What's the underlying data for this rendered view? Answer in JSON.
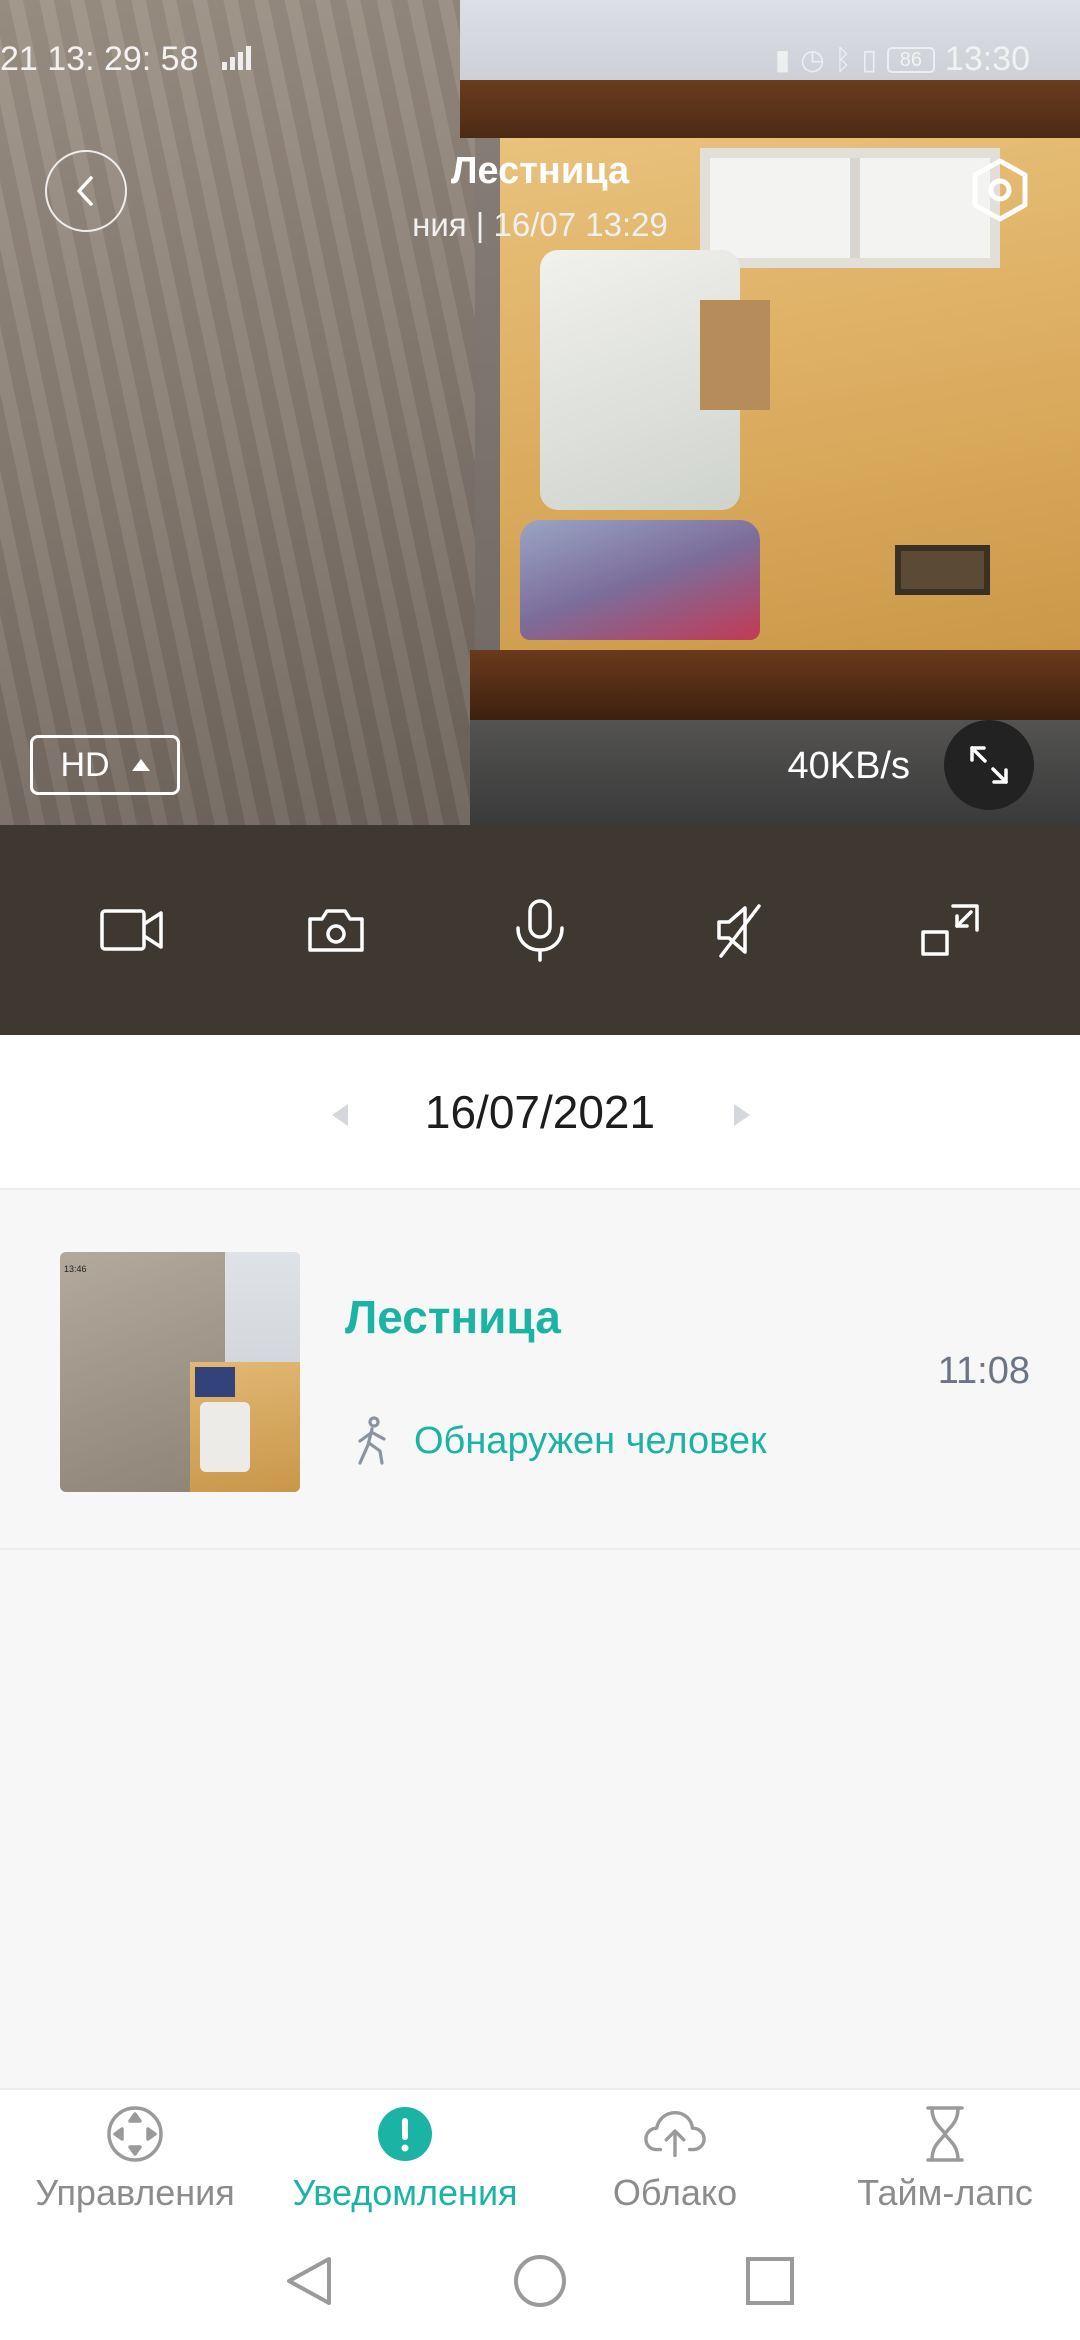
{
  "status_bar": {
    "left_time": "21  13: 29: 58",
    "battery": "86",
    "right_time": "13:30"
  },
  "header": {
    "title": "Лестница",
    "subtitle": "ния | 16/07 13:29"
  },
  "video": {
    "quality_label": "HD",
    "speed": "40KB/s"
  },
  "controls": {
    "items": [
      {
        "name": "record-video-icon"
      },
      {
        "name": "snapshot-camera-icon"
      },
      {
        "name": "microphone-icon"
      },
      {
        "name": "speaker-muted-icon"
      },
      {
        "name": "picture-in-picture-icon"
      }
    ]
  },
  "date_bar": {
    "date": "16/07/2021"
  },
  "event": {
    "title": "Лестница",
    "type": "Обнаружен человек",
    "time": "11:08",
    "thumb_timestamp": "13:46"
  },
  "bottom_nav": {
    "items": [
      {
        "label": "Управления",
        "icon": "control-icon",
        "active": false
      },
      {
        "label": "Уведомления",
        "icon": "alert-icon",
        "active": true
      },
      {
        "label": "Облако",
        "icon": "cloud-upload-icon",
        "active": false
      },
      {
        "label": "Тайм-лапс",
        "icon": "hourglass-icon",
        "active": false
      }
    ]
  },
  "colors": {
    "accent": "#1bb4a4",
    "control_bar": "#3f3830",
    "muted_text": "#8c8c8c"
  }
}
